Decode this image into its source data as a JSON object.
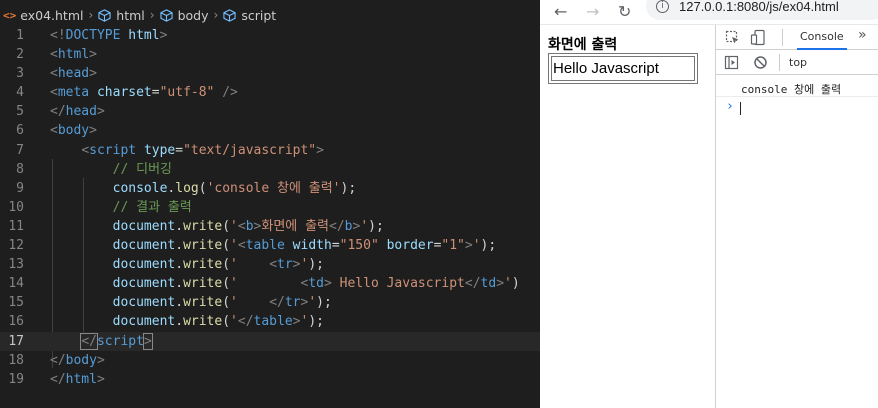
{
  "editor": {
    "breadcrumbs": [
      "ex04.html",
      "html",
      "body",
      "script"
    ],
    "file_icon": "<>",
    "line_numbers": [
      "1",
      "2",
      "3",
      "4",
      "5",
      "6",
      "7",
      "8",
      "9",
      "10",
      "11",
      "12",
      "13",
      "14",
      "15",
      "16",
      "17",
      "18",
      "19"
    ],
    "lines": [
      [
        [
          "t-tag",
          "<!"
        ],
        [
          "t-name",
          "DOCTYPE"
        ],
        [
          "t-plain",
          " "
        ],
        [
          "t-attr",
          "html"
        ],
        [
          "t-tag",
          ">"
        ]
      ],
      [
        [
          "t-tag",
          "<"
        ],
        [
          "t-name",
          "html"
        ],
        [
          "t-tag",
          ">"
        ]
      ],
      [
        [
          "t-tag",
          "<"
        ],
        [
          "t-name",
          "head"
        ],
        [
          "t-tag",
          ">"
        ]
      ],
      [
        [
          "t-tag",
          "<"
        ],
        [
          "t-name",
          "meta"
        ],
        [
          "t-plain",
          " "
        ],
        [
          "t-attr",
          "charset"
        ],
        [
          "t-plain",
          "="
        ],
        [
          "t-str",
          "\"utf-8\""
        ],
        [
          "t-plain",
          " "
        ],
        [
          "t-tag",
          "/>"
        ]
      ],
      [
        [
          "t-tag",
          "</"
        ],
        [
          "t-name",
          "head"
        ],
        [
          "t-tag",
          ">"
        ]
      ],
      [
        [
          "t-tag",
          "<"
        ],
        [
          "t-name",
          "body"
        ],
        [
          "t-tag",
          ">"
        ]
      ],
      [
        [
          "t-plain",
          "    "
        ],
        [
          "t-tag",
          "<"
        ],
        [
          "t-name",
          "script"
        ],
        [
          "t-plain",
          " "
        ],
        [
          "t-attr",
          "type"
        ],
        [
          "t-plain",
          "="
        ],
        [
          "t-str",
          "\"text/javascript\""
        ],
        [
          "t-tag",
          ">"
        ]
      ],
      [
        [
          "t-plain",
          "        "
        ],
        [
          "t-cmt",
          "// 디버깅"
        ]
      ],
      [
        [
          "t-plain",
          "        "
        ],
        [
          "t-var",
          "console"
        ],
        [
          "t-plain",
          "."
        ],
        [
          "t-fn",
          "log"
        ],
        [
          "t-plain",
          "("
        ],
        [
          "t-str",
          "'console 창에 출력'"
        ],
        [
          "t-plain",
          ");"
        ]
      ],
      [
        [
          "t-plain",
          "        "
        ],
        [
          "t-cmt",
          "// 결과 출력"
        ]
      ],
      [
        [
          "t-plain",
          "        "
        ],
        [
          "t-var",
          "document"
        ],
        [
          "t-plain",
          "."
        ],
        [
          "t-fn",
          "write"
        ],
        [
          "t-plain",
          "("
        ],
        [
          "t-str",
          "'"
        ],
        [
          "t-tag",
          "<"
        ],
        [
          "t-name",
          "b"
        ],
        [
          "t-tag",
          ">"
        ],
        [
          "t-str",
          "화면에 출력"
        ],
        [
          "t-tag",
          "</"
        ],
        [
          "t-name",
          "b"
        ],
        [
          "t-tag",
          ">"
        ],
        [
          "t-str",
          "'"
        ],
        [
          "t-plain",
          ");"
        ]
      ],
      [
        [
          "t-plain",
          "        "
        ],
        [
          "t-var",
          "document"
        ],
        [
          "t-plain",
          "."
        ],
        [
          "t-fn",
          "write"
        ],
        [
          "t-plain",
          "("
        ],
        [
          "t-str",
          "'"
        ],
        [
          "t-tag",
          "<"
        ],
        [
          "t-name",
          "table"
        ],
        [
          "t-plain",
          " "
        ],
        [
          "t-attr",
          "width"
        ],
        [
          "t-plain",
          "="
        ],
        [
          "t-str",
          "\"150\""
        ],
        [
          "t-plain",
          " "
        ],
        [
          "t-attr",
          "border"
        ],
        [
          "t-plain",
          "="
        ],
        [
          "t-str",
          "\"1\""
        ],
        [
          "t-tag",
          ">"
        ],
        [
          "t-str",
          "'"
        ],
        [
          "t-plain",
          ");"
        ]
      ],
      [
        [
          "t-plain",
          "        "
        ],
        [
          "t-var",
          "document"
        ],
        [
          "t-plain",
          "."
        ],
        [
          "t-fn",
          "write"
        ],
        [
          "t-plain",
          "("
        ],
        [
          "t-str",
          "'    "
        ],
        [
          "t-tag",
          "<"
        ],
        [
          "t-name",
          "tr"
        ],
        [
          "t-tag",
          ">"
        ],
        [
          "t-str",
          "'"
        ],
        [
          "t-plain",
          ");"
        ]
      ],
      [
        [
          "t-plain",
          "        "
        ],
        [
          "t-var",
          "document"
        ],
        [
          "t-plain",
          "."
        ],
        [
          "t-fn",
          "write"
        ],
        [
          "t-plain",
          "("
        ],
        [
          "t-str",
          "'        "
        ],
        [
          "t-tag",
          "<"
        ],
        [
          "t-name",
          "td"
        ],
        [
          "t-tag",
          ">"
        ],
        [
          "t-str",
          " Hello Javascript"
        ],
        [
          "t-tag",
          "</"
        ],
        [
          "t-name",
          "td"
        ],
        [
          "t-tag",
          ">"
        ],
        [
          "t-str",
          "'"
        ],
        [
          "t-plain",
          ")"
        ]
      ],
      [
        [
          "t-plain",
          "        "
        ],
        [
          "t-var",
          "document"
        ],
        [
          "t-plain",
          "."
        ],
        [
          "t-fn",
          "write"
        ],
        [
          "t-plain",
          "("
        ],
        [
          "t-str",
          "'    "
        ],
        [
          "t-tag",
          "</"
        ],
        [
          "t-name",
          "tr"
        ],
        [
          "t-tag",
          ">"
        ],
        [
          "t-str",
          "'"
        ],
        [
          "t-plain",
          ");"
        ]
      ],
      [
        [
          "t-plain",
          "        "
        ],
        [
          "t-var",
          "document"
        ],
        [
          "t-plain",
          "."
        ],
        [
          "t-fn",
          "write"
        ],
        [
          "t-plain",
          "("
        ],
        [
          "t-str",
          "'"
        ],
        [
          "t-tag",
          "</"
        ],
        [
          "t-name",
          "table"
        ],
        [
          "t-tag",
          ">"
        ],
        [
          "t-str",
          "'"
        ],
        [
          "t-plain",
          ");"
        ]
      ],
      [
        [
          "t-plain",
          "    "
        ],
        [
          "t-tag bracket",
          "</"
        ],
        [
          "t-name",
          "script"
        ],
        [
          "t-tag bracket",
          ">"
        ]
      ],
      [
        [
          "t-tag",
          "</"
        ],
        [
          "t-name",
          "body"
        ],
        [
          "t-tag",
          ">"
        ]
      ],
      [
        [
          "t-tag",
          "</"
        ],
        [
          "t-name",
          "html"
        ],
        [
          "t-tag",
          ">"
        ]
      ]
    ],
    "current_line": 17
  },
  "browser": {
    "back_icon": "←",
    "forward_icon": "→",
    "reload_icon": "↻",
    "info_icon": "i",
    "url": "127.0.0.1:8080/js/ex04.html",
    "page_heading": "화면에 출력",
    "table_cell": "Hello Javascript"
  },
  "devtools": {
    "tab_label": "Console",
    "more_icon": "»",
    "context": "top",
    "log_message": "console 창에 출력",
    "prompt_icon": "›"
  },
  "colors": {
    "editor_bg": "#1e1e1e",
    "tag": "#569cd6",
    "attribute": "#9cdcfe",
    "string": "#ce9178",
    "comment": "#6a9955",
    "function": "#dcdcaa",
    "active_tab_underline": "#1a73e8"
  }
}
